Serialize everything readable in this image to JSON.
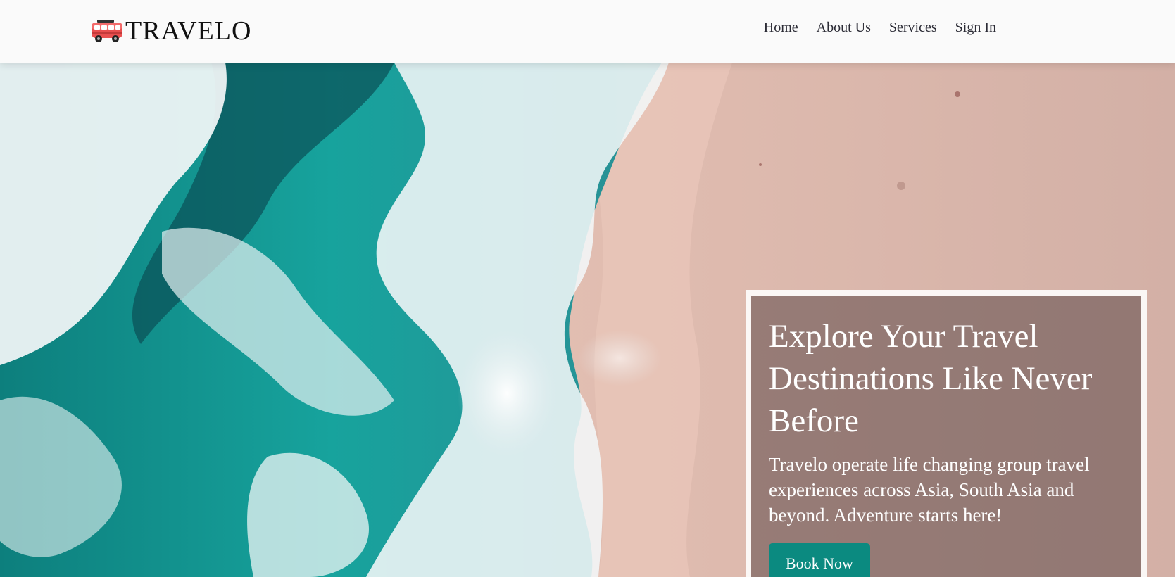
{
  "brand": {
    "name": "TRAVELO",
    "icon": "van-icon"
  },
  "nav": {
    "items": [
      {
        "label": "Home"
      },
      {
        "label": "About Us"
      },
      {
        "label": "Services"
      },
      {
        "label": "Sign In"
      }
    ]
  },
  "hero": {
    "background": "aerial-beach-waves-photo",
    "title": "Explore Your Travel Destinations Like Never Before",
    "description": "Travelo operate life changing group travel experiences across Asia, South Asia and beyond. Adventure starts here!",
    "cta_label": "Book Now"
  },
  "colors": {
    "accent": "#0b8a80",
    "navbar_bg": "#fafafa",
    "text_dark": "#111111"
  }
}
